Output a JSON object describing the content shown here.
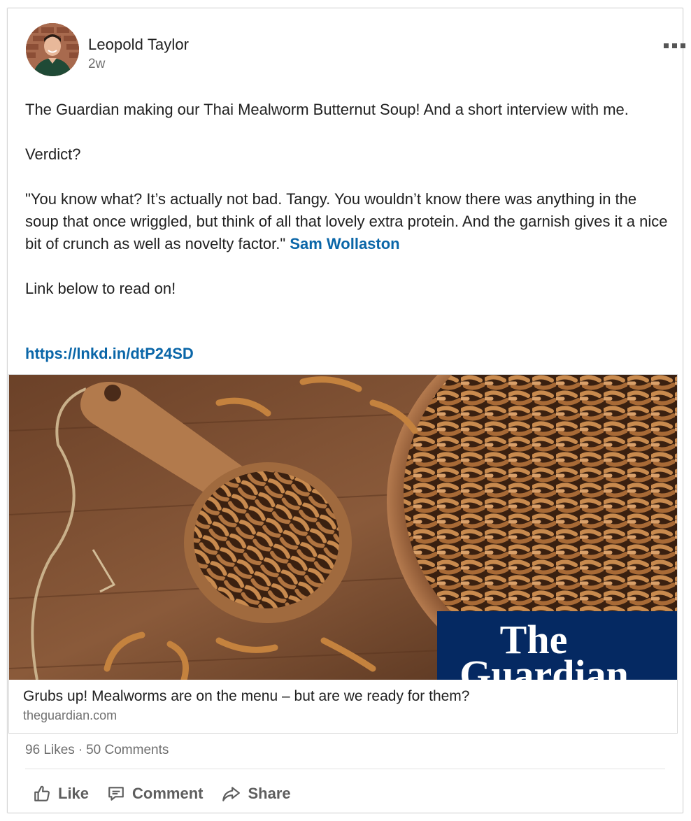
{
  "post": {
    "author_name": "Leopold Taylor",
    "time": "2w",
    "paragraph1": "The Guardian making our Thai Mealworm Butternut Soup! And a short interview with me.",
    "paragraph2": "Verdict?",
    "quote": "\"You know what? It’s actually not bad. Tangy. You wouldn’t know there was anything in the soup that once wriggled, but think of all that lovely extra protein. And the garnish gives it a nice bit of crunch as well as novelty factor.\" ",
    "quote_author": "Sam Wollaston",
    "paragraph4": "Link below to read on!",
    "url": "https://lnkd.in/dtP24SD"
  },
  "link_preview": {
    "logo_line1": "The",
    "logo_line2": "Guardian",
    "title": "Grubs up! Mealworms are on the menu – but are we ready for them?",
    "domain": "theguardian.com"
  },
  "social": {
    "likes": "96 Likes",
    "separator": "·",
    "comments": "50 Comments"
  },
  "actions": {
    "like": "Like",
    "comment": "Comment",
    "share": "Share"
  },
  "colors": {
    "link": "#0a66a8",
    "guardian_blue": "#052962"
  }
}
